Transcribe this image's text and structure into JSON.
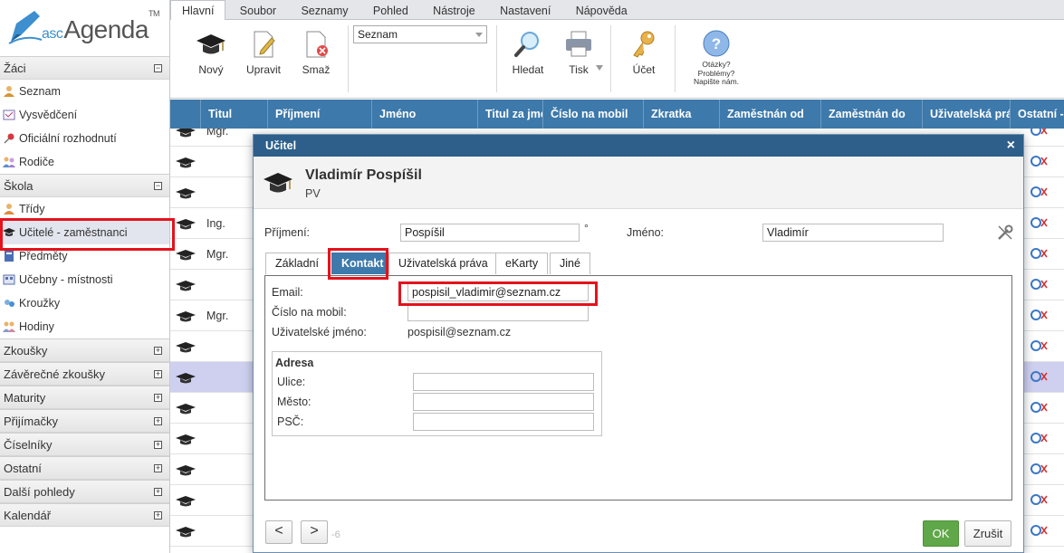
{
  "logo": {
    "prefix": "asc",
    "name": "Agenda",
    "tm": "TM"
  },
  "sidebar": {
    "zaci": {
      "title": "Žáci",
      "toggle": "−",
      "items": [
        {
          "label": "Seznam",
          "icon": "users-icon"
        },
        {
          "label": "Vysvědčení",
          "icon": "certificate-icon"
        },
        {
          "label": "Oficiální rozhodnutí",
          "icon": "pin-icon"
        },
        {
          "label": "Rodiče",
          "icon": "parents-icon"
        }
      ]
    },
    "skola": {
      "title": "Škola",
      "toggle": "−",
      "items": [
        {
          "label": "Třídy",
          "icon": "class-icon"
        },
        {
          "label": "Učitelé - zaměstnanci",
          "icon": "graduation-cap-icon"
        },
        {
          "label": "Předměty",
          "icon": "book-icon"
        },
        {
          "label": "Učebny - místnosti",
          "icon": "room-icon"
        },
        {
          "label": "Kroužky",
          "icon": "club-icon"
        },
        {
          "label": "Hodiny",
          "icon": "lessons-icon"
        }
      ]
    },
    "collapsed": [
      {
        "title": "Zkoušky",
        "toggle": "+"
      },
      {
        "title": "Závěrečné zkoušky",
        "toggle": "+"
      },
      {
        "title": "Maturity",
        "toggle": "+"
      },
      {
        "title": "Přijímačky",
        "toggle": "+"
      },
      {
        "title": "Číselníky",
        "toggle": "+"
      },
      {
        "title": "Ostatní",
        "toggle": "+"
      },
      {
        "title": "Další pohledy",
        "toggle": "+"
      },
      {
        "title": "Kalendář",
        "toggle": "+"
      }
    ]
  },
  "menu": [
    "Hlavní",
    "Soubor",
    "Seznamy",
    "Pohled",
    "Nástroje",
    "Nastavení",
    "Nápověda"
  ],
  "toolbar": {
    "new": "Nový",
    "edit": "Upravit",
    "delete": "Smaž",
    "view_select": "Seznam",
    "search": "Hledat",
    "print": "Tisk",
    "account": "Účet",
    "help": [
      "Otázky?",
      "Problémy?",
      "Napište nám."
    ]
  },
  "grid": {
    "columns": [
      "Titul",
      "Příjmení",
      "Jméno",
      "Titul za jmé",
      "Číslo na mobil",
      "Zkratka",
      "Zaměstnán od",
      "Zaměstnán do",
      "Uživatelská prá",
      "Ostatní -"
    ],
    "row_titles": [
      "Mgr.",
      "",
      "",
      "Ing.",
      "Mgr.",
      "",
      "Mgr.",
      "",
      "",
      "",
      "",
      "",
      "",
      ""
    ]
  },
  "modal": {
    "title": "Učitel",
    "close": "×",
    "teacher_name": "Vladimír Pospíšil",
    "abbreviation": "PV",
    "surname_label": "Příjmení:",
    "surname_value": "Pospíšil",
    "surname_mark": "°",
    "firstname_label": "Jméno:",
    "firstname_value": "Vladimír",
    "tabs": [
      "Základní",
      "Kontakt",
      "Uživatelská práva",
      "eKarty",
      "Jiné"
    ],
    "email_label": "Email:",
    "email_value": "pospisil_vladimir@seznam.cz",
    "mobile_label": "Číslo na mobil:",
    "mobile_value": "",
    "username_label": "Uživatelské jméno:",
    "username_value": "pospisil@seznam.cz",
    "address": {
      "title": "Adresa",
      "street": "Ulice:",
      "city": "Město:",
      "zip": "PSČ:"
    },
    "prev": "<",
    "next": ">",
    "counter": "-6",
    "ok": "OK",
    "cancel": "Zrušit"
  }
}
